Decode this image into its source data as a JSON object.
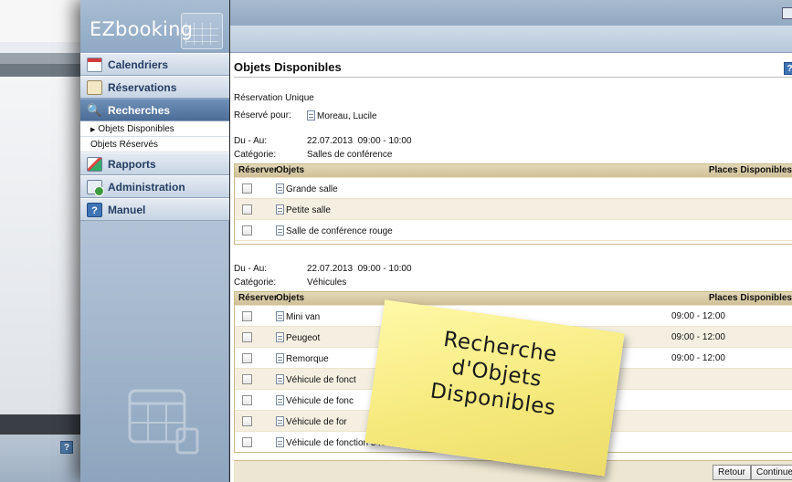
{
  "sidebar": {
    "logo": "EZbooking",
    "nav": [
      {
        "label": "Calendriers",
        "icon": "calendar-icon"
      },
      {
        "label": "Réservations",
        "icon": "reservations-icon"
      },
      {
        "label": "Recherches",
        "icon": "search-icon",
        "active": true
      },
      {
        "label": "Rapports",
        "icon": "chart-icon"
      },
      {
        "label": "Administration",
        "icon": "admin-icon"
      },
      {
        "label": "Manuel",
        "icon": "help-icon"
      }
    ],
    "sub_items": [
      "Objets Disponibles",
      "Objets Réservés"
    ]
  },
  "header": {
    "help": "?"
  },
  "page": {
    "title": "Objets Disponibles",
    "reservation_type": "Réservation Unique",
    "reserved_for_label": "Réservé pour:",
    "reserved_for_value": "Moreau, Lucile"
  },
  "section1": {
    "date_label": "Du - Au:",
    "date_value": "22.07.2013  09:00 - 10:00",
    "category_label": "Catégorie:",
    "category_value": "Salles de conférence",
    "columns": {
      "reserve": "Réserver",
      "objects": "Objets",
      "places": "Places Disponibles"
    },
    "rows": [
      {
        "name": "Grande salle",
        "time": ""
      },
      {
        "name": "Petite salle",
        "time": ""
      },
      {
        "name": "Salle de conférence rouge",
        "time": ""
      }
    ]
  },
  "section2": {
    "date_label": "Du - Au:",
    "date_value": "22.07.2013  09:00 - 10:00",
    "category_label": "Catégorie:",
    "category_value": "Véhicules",
    "columns": {
      "reserve": "Réserver",
      "objects": "Objets",
      "places": "Places Disponibles"
    },
    "rows": [
      {
        "name": "Mini van",
        "time": "09:00 - 12:00"
      },
      {
        "name": "Peugeot",
        "time": "09:00 - 12:00"
      },
      {
        "name": "Remorque",
        "time": "09:00 - 12:00"
      },
      {
        "name": "Véhicule de fonct",
        "time": ""
      },
      {
        "name": "Véhicule de fonc",
        "time": ""
      },
      {
        "name": "Véhicule de for",
        "time": ""
      },
      {
        "name": "Véhicule de fonction 5486",
        "time": ""
      }
    ]
  },
  "buttons": {
    "back": "Retour",
    "continue": "Continuer"
  },
  "sticky_note": {
    "lines": [
      "Recherche",
      "d'Objets",
      "Disponibles"
    ]
  },
  "colors": {
    "sidebar": "#aebfd3",
    "active_nav": "#4b6d97",
    "table_header": "#cfc096",
    "sticky": "#f5e87a"
  }
}
